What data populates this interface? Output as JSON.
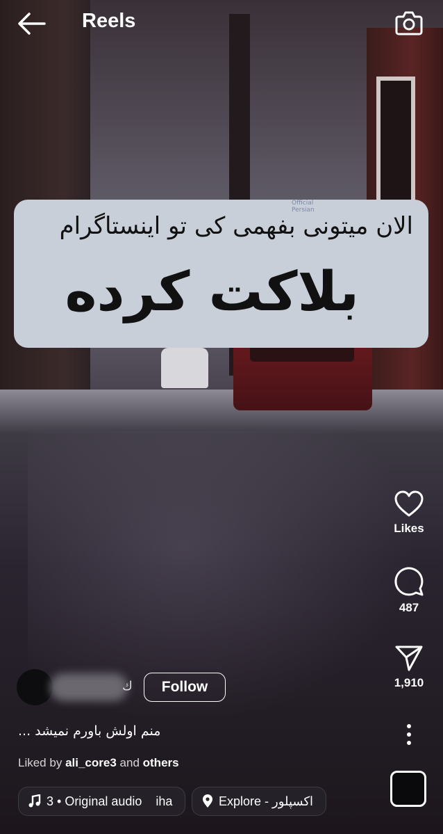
{
  "header": {
    "title": "Reels"
  },
  "overlay_card": {
    "line1": "الان میتونی بفهمی کی تو اینستاگرام",
    "line2": "بلاکت کرده",
    "watermark_line1": "Official",
    "watermark_line2": "Persian"
  },
  "actions": {
    "likes_label": "Likes",
    "comments_count": "487",
    "shares_count": "1,910"
  },
  "post": {
    "username_suffix": "ﻙ",
    "follow_label": "Follow",
    "caption": "منم اولش باورم نمیشد ...",
    "liked_by_prefix": "Liked by",
    "liked_by_user": "ali_core3",
    "liked_by_and": "and",
    "liked_by_others": "others"
  },
  "audio": {
    "text": "3 • Original audio",
    "trailing": "iha"
  },
  "explore": {
    "text": "Explore - اکسپلور"
  },
  "icons": {
    "back": "back-arrow-icon",
    "camera": "camera-icon",
    "like": "heart-icon",
    "comment": "comment-icon",
    "share": "send-icon",
    "more": "more-vertical-icon",
    "music": "music-note-icon",
    "location": "location-pin-icon"
  }
}
